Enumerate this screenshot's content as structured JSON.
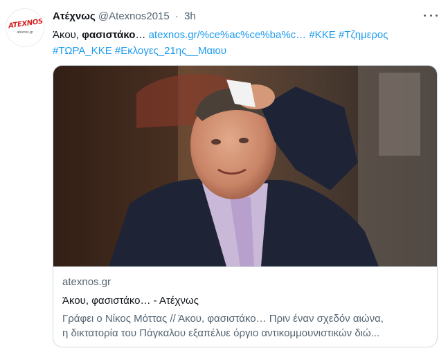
{
  "tweet": {
    "avatar": {
      "logo_text": "ATEXNOS",
      "logo_sub": "atexnos.gr"
    },
    "author_name": "Ατέχνως",
    "handle": "@Atexnos2015",
    "separator": "·",
    "time": "3h",
    "text": {
      "lead": "Άκου, ",
      "bold": "φασιστάκο",
      "ellipsis": "… ",
      "url": "atexnos.gr/%ce%ac%ce%ba%c…",
      "hashtags_line1": [
        "#ΚΚΕ",
        "#Τζημερος"
      ],
      "hashtags_line2": [
        "#ΤΩΡΑ_ΚΚΕ",
        "#Εκλογες_21ης__Μαιου"
      ]
    },
    "card": {
      "domain": "atexnos.gr",
      "title": "Άκου, φασιστάκο… - Ατέχνως",
      "description_line1": "Γράφει ο Νίκος Μόττας // Άκου, φασιστάκο… Πριν έναν σχεδόν αιώνα,",
      "description_line2": "η δικτατορία του Πάγκαλου εξαπέλυε όργιο αντικομμουνιστικών διώ..."
    }
  },
  "colors": {
    "link": "#1d9bf0",
    "secondary_text": "#536471",
    "border": "#cfd9de"
  }
}
